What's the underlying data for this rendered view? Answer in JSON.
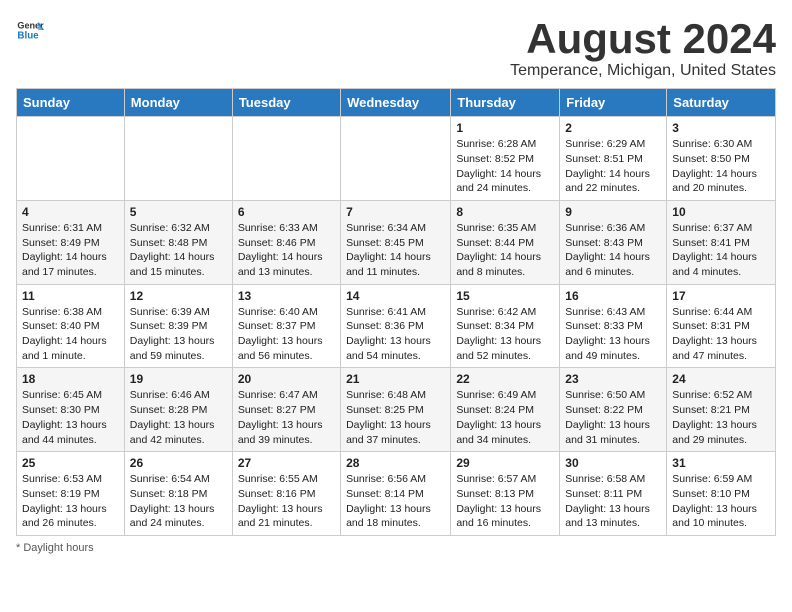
{
  "header": {
    "logo_line1": "General",
    "logo_line2": "Blue",
    "title": "August 2024",
    "subtitle": "Temperance, Michigan, United States"
  },
  "columns": [
    "Sunday",
    "Monday",
    "Tuesday",
    "Wednesday",
    "Thursday",
    "Friday",
    "Saturday"
  ],
  "weeks": [
    [
      {
        "num": "",
        "sunrise": "",
        "sunset": "",
        "daylight": ""
      },
      {
        "num": "",
        "sunrise": "",
        "sunset": "",
        "daylight": ""
      },
      {
        "num": "",
        "sunrise": "",
        "sunset": "",
        "daylight": ""
      },
      {
        "num": "",
        "sunrise": "",
        "sunset": "",
        "daylight": ""
      },
      {
        "num": "1",
        "sunrise": "6:28 AM",
        "sunset": "8:52 PM",
        "daylight": "14 hours and 24 minutes."
      },
      {
        "num": "2",
        "sunrise": "6:29 AM",
        "sunset": "8:51 PM",
        "daylight": "14 hours and 22 minutes."
      },
      {
        "num": "3",
        "sunrise": "6:30 AM",
        "sunset": "8:50 PM",
        "daylight": "14 hours and 20 minutes."
      }
    ],
    [
      {
        "num": "4",
        "sunrise": "6:31 AM",
        "sunset": "8:49 PM",
        "daylight": "14 hours and 17 minutes."
      },
      {
        "num": "5",
        "sunrise": "6:32 AM",
        "sunset": "8:48 PM",
        "daylight": "14 hours and 15 minutes."
      },
      {
        "num": "6",
        "sunrise": "6:33 AM",
        "sunset": "8:46 PM",
        "daylight": "14 hours and 13 minutes."
      },
      {
        "num": "7",
        "sunrise": "6:34 AM",
        "sunset": "8:45 PM",
        "daylight": "14 hours and 11 minutes."
      },
      {
        "num": "8",
        "sunrise": "6:35 AM",
        "sunset": "8:44 PM",
        "daylight": "14 hours and 8 minutes."
      },
      {
        "num": "9",
        "sunrise": "6:36 AM",
        "sunset": "8:43 PM",
        "daylight": "14 hours and 6 minutes."
      },
      {
        "num": "10",
        "sunrise": "6:37 AM",
        "sunset": "8:41 PM",
        "daylight": "14 hours and 4 minutes."
      }
    ],
    [
      {
        "num": "11",
        "sunrise": "6:38 AM",
        "sunset": "8:40 PM",
        "daylight": "14 hours and 1 minute."
      },
      {
        "num": "12",
        "sunrise": "6:39 AM",
        "sunset": "8:39 PM",
        "daylight": "13 hours and 59 minutes."
      },
      {
        "num": "13",
        "sunrise": "6:40 AM",
        "sunset": "8:37 PM",
        "daylight": "13 hours and 56 minutes."
      },
      {
        "num": "14",
        "sunrise": "6:41 AM",
        "sunset": "8:36 PM",
        "daylight": "13 hours and 54 minutes."
      },
      {
        "num": "15",
        "sunrise": "6:42 AM",
        "sunset": "8:34 PM",
        "daylight": "13 hours and 52 minutes."
      },
      {
        "num": "16",
        "sunrise": "6:43 AM",
        "sunset": "8:33 PM",
        "daylight": "13 hours and 49 minutes."
      },
      {
        "num": "17",
        "sunrise": "6:44 AM",
        "sunset": "8:31 PM",
        "daylight": "13 hours and 47 minutes."
      }
    ],
    [
      {
        "num": "18",
        "sunrise": "6:45 AM",
        "sunset": "8:30 PM",
        "daylight": "13 hours and 44 minutes."
      },
      {
        "num": "19",
        "sunrise": "6:46 AM",
        "sunset": "8:28 PM",
        "daylight": "13 hours and 42 minutes."
      },
      {
        "num": "20",
        "sunrise": "6:47 AM",
        "sunset": "8:27 PM",
        "daylight": "13 hours and 39 minutes."
      },
      {
        "num": "21",
        "sunrise": "6:48 AM",
        "sunset": "8:25 PM",
        "daylight": "13 hours and 37 minutes."
      },
      {
        "num": "22",
        "sunrise": "6:49 AM",
        "sunset": "8:24 PM",
        "daylight": "13 hours and 34 minutes."
      },
      {
        "num": "23",
        "sunrise": "6:50 AM",
        "sunset": "8:22 PM",
        "daylight": "13 hours and 31 minutes."
      },
      {
        "num": "24",
        "sunrise": "6:52 AM",
        "sunset": "8:21 PM",
        "daylight": "13 hours and 29 minutes."
      }
    ],
    [
      {
        "num": "25",
        "sunrise": "6:53 AM",
        "sunset": "8:19 PM",
        "daylight": "13 hours and 26 minutes."
      },
      {
        "num": "26",
        "sunrise": "6:54 AM",
        "sunset": "8:18 PM",
        "daylight": "13 hours and 24 minutes."
      },
      {
        "num": "27",
        "sunrise": "6:55 AM",
        "sunset": "8:16 PM",
        "daylight": "13 hours and 21 minutes."
      },
      {
        "num": "28",
        "sunrise": "6:56 AM",
        "sunset": "8:14 PM",
        "daylight": "13 hours and 18 minutes."
      },
      {
        "num": "29",
        "sunrise": "6:57 AM",
        "sunset": "8:13 PM",
        "daylight": "13 hours and 16 minutes."
      },
      {
        "num": "30",
        "sunrise": "6:58 AM",
        "sunset": "8:11 PM",
        "daylight": "13 hours and 13 minutes."
      },
      {
        "num": "31",
        "sunrise": "6:59 AM",
        "sunset": "8:10 PM",
        "daylight": "13 hours and 10 minutes."
      }
    ]
  ],
  "footer": {
    "label": "Daylight hours"
  },
  "labels": {
    "sunrise_prefix": "Sunrise: ",
    "sunset_prefix": "Sunset: ",
    "daylight_prefix": "Daylight: "
  }
}
